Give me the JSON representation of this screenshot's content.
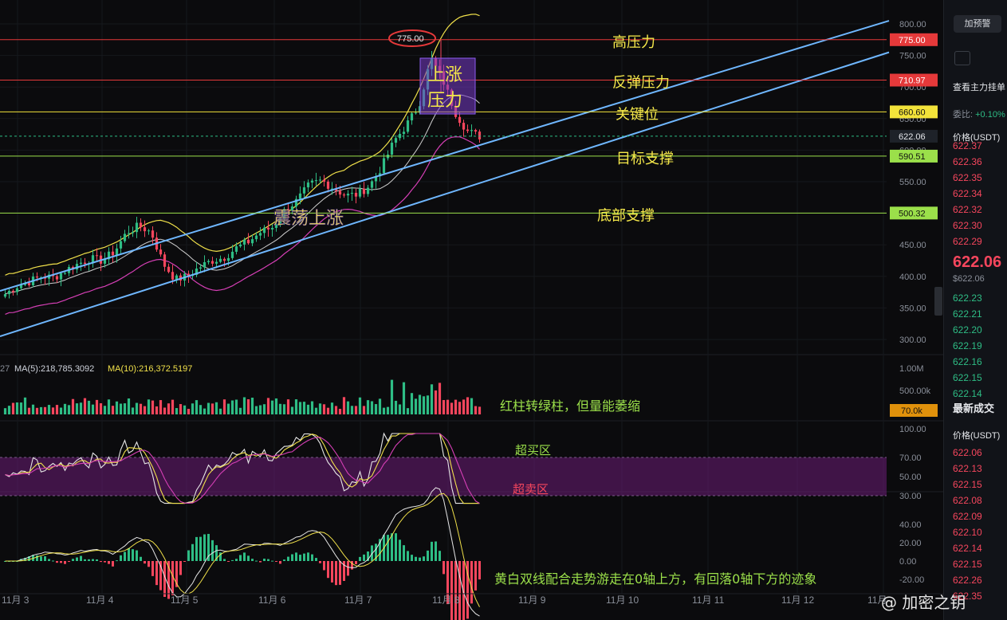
{
  "chart_data": [
    {
      "type": "candlestick",
      "x_ticks": [
        "11月 3",
        "11月 4",
        "11月 5",
        "11月 6",
        "11月 7",
        "11月 8",
        "11月 9",
        "11月 10",
        "11月 11",
        "11月 12",
        "11月"
      ],
      "y_ticks": [
        "800.00",
        "750.00",
        "700.00",
        "650.00",
        "600.00",
        "550.00",
        "500.00",
        "450.00",
        "400.00",
        "350.00",
        "300.00"
      ],
      "ylim": [
        280,
        815
      ],
      "current_price": "622.06",
      "high_marker": "775.00",
      "levels": [
        {
          "price": 775.0,
          "label": "775.00",
          "name": "高压力",
          "color": "#e5393a"
        },
        {
          "price": 710.97,
          "label": "710.97",
          "name": "反弹压力",
          "color": "#e5393a"
        },
        {
          "price": 660.6,
          "label": "660.60",
          "name": "关键位",
          "color": "#f3e33a"
        },
        {
          "price": 590.51,
          "label": "590.51",
          "name": "目标支撑",
          "color": "#9be04a"
        },
        {
          "price": 500.32,
          "label": "500.32",
          "name": "底部支撑",
          "color": "#9be04a"
        }
      ],
      "annotations": {
        "top_box": [
          "上涨",
          "压力"
        ],
        "mid": "震荡上涨"
      },
      "price_path": [
        372,
        385,
        392,
        400,
        398,
        410,
        420,
        428,
        425,
        440,
        470,
        480,
        470,
        420,
        395,
        400,
        415,
        425,
        430,
        445,
        455,
        470,
        478,
        505,
        520,
        545,
        552,
        540,
        528,
        530,
        545,
        575,
        615,
        640,
        670,
        745,
        710,
        660,
        630,
        622
      ]
    },
    {
      "type": "bar",
      "name": "volume",
      "labels": [
        "MA(5):218,785.3092",
        "MA(10):216,372.5197"
      ],
      "y_ticks": [
        "1.00M",
        "500.00k"
      ],
      "current": "70.0k",
      "note": "红柱转绿柱，但量能萎缩"
    },
    {
      "type": "line",
      "name": "RSI",
      "y_ticks": [
        "100.00",
        "70.00",
        "50.00",
        "30.00"
      ],
      "zones": {
        "overbought": "超买区",
        "oversold": "超卖区",
        "upper": 70,
        "lower": 30
      }
    },
    {
      "type": "bar",
      "name": "MACD",
      "y_ticks": [
        "40.00",
        "20.00",
        "0.00",
        "-20.00"
      ],
      "note": "黄白双线配合走势游走在0轴上方，有回落0轴下方的迹象"
    }
  ],
  "side": {
    "alert_button": "加预警",
    "section_title": "查看主力挂单",
    "ratio_label": "委比:",
    "ratio_value": "+0.10%",
    "price_header": "价格(USDT)",
    "asks": [
      "622.37",
      "622.36",
      "622.35",
      "622.34",
      "622.32",
      "622.30",
      "622.29"
    ],
    "last_price": "622.06",
    "last_price_sub": "$622.06",
    "bids": [
      "622.23",
      "622.21",
      "622.20",
      "622.19",
      "622.16",
      "622.15",
      "622.14"
    ],
    "trades_title": "最新成交",
    "trades_header": "价格(USDT)",
    "trades": [
      {
        "p": "622.06",
        "c": "ask"
      },
      {
        "p": "622.13",
        "c": "ask"
      },
      {
        "p": "622.15",
        "c": "ask"
      },
      {
        "p": "622.08",
        "c": "ask"
      },
      {
        "p": "622.09",
        "c": "ask"
      },
      {
        "p": "622.10",
        "c": "ask"
      },
      {
        "p": "622.14",
        "c": "ask"
      },
      {
        "p": "622.15",
        "c": "ask"
      },
      {
        "p": "622.26",
        "c": "ask"
      },
      {
        "p": "622.35",
        "c": "ask"
      }
    ]
  },
  "watermark": "@ 加密之钥",
  "colors": {
    "up": "#2ebd85",
    "down": "#f6465d",
    "channel": "#6fb7ff",
    "ma_yellow": "#f0e04a",
    "ma_white": "#cfcfcf",
    "ma_magenta": "#d63fb6"
  }
}
